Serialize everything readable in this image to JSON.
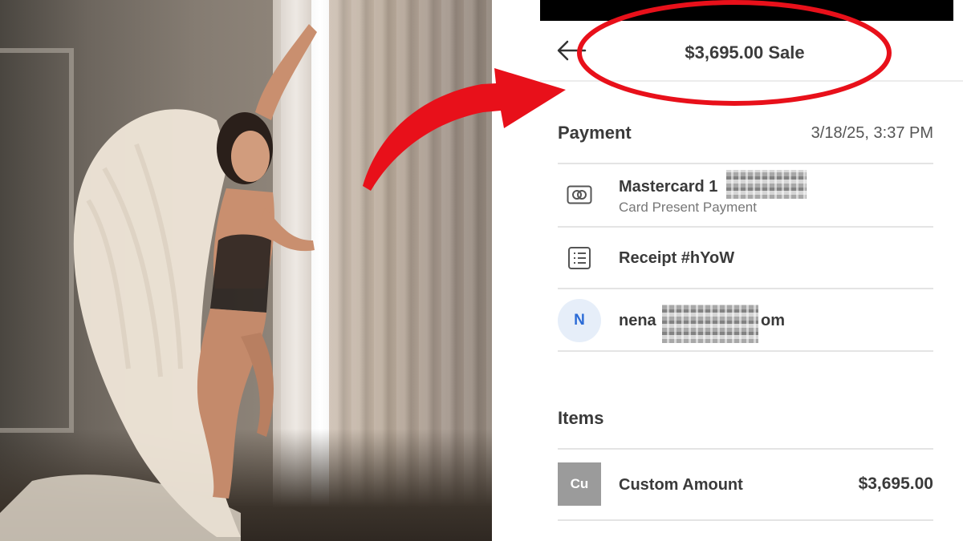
{
  "photo": {
    "subject": "woman-with-angel-wings-photo"
  },
  "receipt": {
    "header": {
      "title": "$3,695.00 Sale",
      "back_icon": "arrow-left-icon"
    },
    "payment": {
      "section_title": "Payment",
      "datetime": "3/18/25, 3:37 PM",
      "card": {
        "icon": "card-icon",
        "primary": "Mastercard 1",
        "secondary": "Card Present Payment"
      },
      "receipt": {
        "icon": "receipt-list-icon",
        "primary": "Receipt #hYoW"
      },
      "customer": {
        "avatar_initial": "N",
        "email_start": "nena",
        "email_end": "om"
      }
    },
    "items": {
      "section_title": "Items",
      "list": [
        {
          "tile": "Cu",
          "name": "Custom Amount",
          "price": "$3,695.00"
        }
      ]
    }
  },
  "annotation": {
    "color": "#e8101a",
    "arrow_icon": "red-curved-arrow-icon",
    "highlight": "red-ellipse-highlight"
  }
}
